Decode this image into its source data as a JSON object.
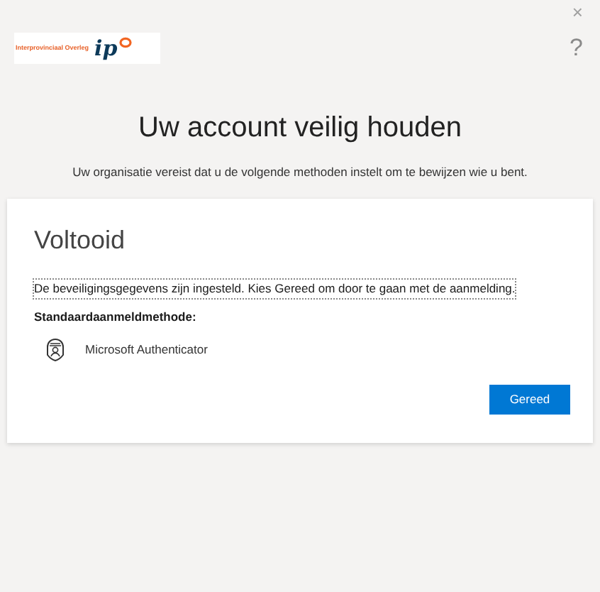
{
  "header": {
    "logo_text": "Interprovinciaal Overleg",
    "logo_mark": "ip",
    "close": "×",
    "help": "?"
  },
  "title": "Uw account veilig houden",
  "subtitle": "Uw organisatie vereist dat u de volgende methoden instelt om te bewijzen wie u bent.",
  "card": {
    "heading": "Voltooid",
    "message": "De beveiligingsgegevens zijn ingesteld. Kies Gereed om door te gaan met de aanmelding.",
    "default_label": "Standaardaanmeldmethode:",
    "method": "Microsoft Authenticator",
    "button": "Gereed"
  }
}
